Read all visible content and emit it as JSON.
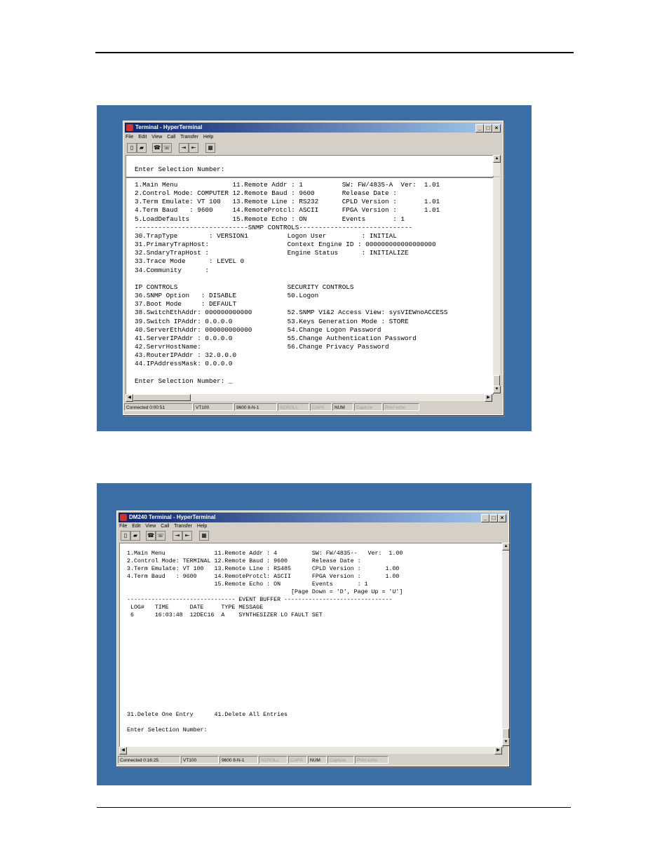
{
  "window1": {
    "title": "Terminal - HyperTerminal",
    "menu": [
      "File",
      "Edit",
      "View",
      "Call",
      "Transfer",
      "Help"
    ],
    "header_prompt": "Enter Selection Number:",
    "lines": [
      "1.Main Menu              11.Remote Addr : 1          SW: FW/4835-A  Ver:  1.01",
      "2.Control Mode: COMPUTER 12.Remote Baud : 9600       Release Date :",
      "3.Term Emulate: VT 100   13.Remote Line : RS232      CPLD Version :       1.01",
      "4.Term Baud   : 9600     14.RemoteProtcl: ASCII      FPGA Version :       1.01",
      "5.LoadDefaults           15.Remote Echo : ON         Events       : 1",
      "-----------------------------SNMP CONTROLS-----------------------------",
      "30.TrapType        : VERSION1          Logon User         : INITIAL",
      "31.PrimaryTrapHost:                    Context Engine ID : 000000000000000000",
      "32.SndaryTrapHost :                    Engine Status      : INITIALIZE",
      "33.Trace Mode      : LEVEL 0",
      "34.Community      :",
      "",
      "IP CONTROLS                            SECURITY CONTROLS",
      "36.SNMP Option   : DISABLE             50.Logon",
      "37.Boot Mode     : DEFAULT",
      "38.SwitchEthAddr: 000000000000         52.SNMP V1&2 Access View: sysVIEWnoACCESS",
      "39.Switch IPAddr: 0.0.0.0              53.Keys Generation Mode : STORE",
      "40.ServerEthAddr: 000000000000         54.Change Logon Password",
      "41.ServerIPAddr : 0.0.0.0              55.Change Authentication Password",
      "42.ServrHostName:                      56.Change Privacy Password",
      "43.RouterIPAddr : 32.0.0.0",
      "44.IPAddressMask: 0.0.0.0",
      "",
      "Enter Selection Number: _"
    ],
    "status": [
      "Connected 0:00:51",
      "VT100",
      "9600 8-N-1",
      "SCROLL",
      "CAPS",
      "NUM",
      "Capture",
      "Print echo"
    ]
  },
  "window2": {
    "title": "DM240 Terminal - HyperTerminal",
    "menu": [
      "File",
      "Edit",
      "View",
      "Call",
      "Transfer",
      "Help"
    ],
    "lines": [
      "1.Main Menu              11.Remote Addr : 4          SW: FW/4835--   Ver:  1.00",
      "2.Control Mode: TERMINAL 12.Remote Baud : 9600       Release Date :",
      "3.Term Emulate: VT 100   13.Remote Line : RS485      CPLD Version :       1.00",
      "4.Term Baud   : 9600     14.RemoteProtcl: ASCII      FPGA Version :       1.00",
      "                         15.Remote Echo : ON         Events       : 1",
      "                                               [Page Down = 'D', Page Up = 'U']",
      "------------------------------- EVENT BUFFER -------------------------------",
      " LOG#   TIME      DATE     TYPE MESSAGE",
      " 6      16:03:48  12DEC16  A    SYNTHESIZER LO FAULT SET",
      "",
      "",
      "",
      "",
      "",
      "",
      "",
      "",
      "",
      "",
      "",
      "",
      "31.Delete One Entry      41.Delete All Entries",
      "",
      "Enter Selection Number:"
    ],
    "status": [
      "Connected 0:16:25",
      "VT100",
      "9600 8-N-1",
      "SCROLL",
      "CAPS",
      "NUM",
      "Capture",
      "Print echo"
    ]
  }
}
